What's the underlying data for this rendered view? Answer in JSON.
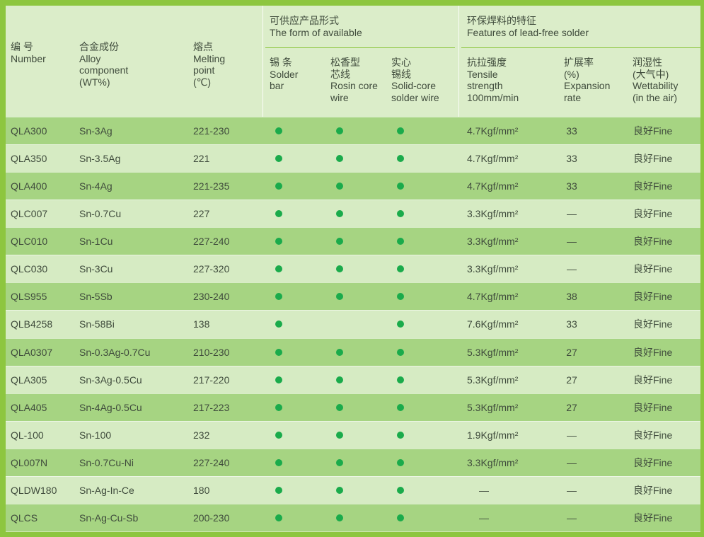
{
  "colors": {
    "frame": "#8dc63f",
    "header_bg": "#dbedc9",
    "row_dark": "#a6d482",
    "row_light": "#d6ebc3",
    "dot": "#1aab4b",
    "rule": "#8dc63f",
    "text": "#3f4b3c"
  },
  "header": {
    "number": {
      "lines": [
        "编 号",
        "Number"
      ]
    },
    "alloy": {
      "lines": [
        "合金成份",
        "Alloy",
        "component",
        "(WT%)"
      ]
    },
    "melting": {
      "lines": [
        "熔点",
        "Melting",
        "point",
        "(℃)"
      ]
    },
    "form_group": {
      "lines": [
        "可供应产品形式",
        "The form of available"
      ],
      "solder_bar": {
        "lines": [
          "锡 条",
          "Solder",
          "bar"
        ]
      },
      "rosin_core_wire": {
        "lines": [
          "松香型",
          "芯线",
          "Rosin core",
          "wire"
        ]
      },
      "solid_core_wire": {
        "lines": [
          "实心",
          "锡线",
          "Solid-core",
          "solder wire"
        ]
      }
    },
    "features_group": {
      "lines": [
        "环保焊料的特征",
        "Features of lead-free solder"
      ],
      "tensile": {
        "lines": [
          "抗拉强度",
          "Tensile",
          "strength",
          "100mm/min"
        ]
      },
      "expansion": {
        "lines": [
          "扩展率",
          "(%)",
          "Expansion",
          "rate"
        ]
      },
      "wettability": {
        "lines": [
          "润湿性",
          "(大气中)",
          "Wettability",
          "(in the air)"
        ]
      }
    }
  },
  "rows": [
    {
      "number": "QLA300",
      "alloy": "Sn-3Ag",
      "melting_point": "221-230",
      "solder_bar": true,
      "rosin_core_wire": true,
      "solid_core_wire": true,
      "tensile_strength": "4.7Kgf/mm²",
      "expansion_rate": "33",
      "wettability": "良好Fine"
    },
    {
      "number": "QLA350",
      "alloy": "Sn-3.5Ag",
      "melting_point": "221",
      "solder_bar": true,
      "rosin_core_wire": true,
      "solid_core_wire": true,
      "tensile_strength": "4.7Kgf/mm²",
      "expansion_rate": "33",
      "wettability": "良好Fine"
    },
    {
      "number": "QLA400",
      "alloy": "Sn-4Ag",
      "melting_point": "221-235",
      "solder_bar": true,
      "rosin_core_wire": true,
      "solid_core_wire": true,
      "tensile_strength": "4.7Kgf/mm²",
      "expansion_rate": "33",
      "wettability": "良好Fine"
    },
    {
      "number": "QLC007",
      "alloy": "Sn-0.7Cu",
      "melting_point": "227",
      "solder_bar": true,
      "rosin_core_wire": true,
      "solid_core_wire": true,
      "tensile_strength": "3.3Kgf/mm²",
      "expansion_rate": "—",
      "wettability": "良好Fine"
    },
    {
      "number": "QLC010",
      "alloy": "Sn-1Cu",
      "melting_point": "227-240",
      "solder_bar": true,
      "rosin_core_wire": true,
      "solid_core_wire": true,
      "tensile_strength": "3.3Kgf/mm²",
      "expansion_rate": "—",
      "wettability": "良好Fine"
    },
    {
      "number": "QLC030",
      "alloy": "Sn-3Cu",
      "melting_point": "227-320",
      "solder_bar": true,
      "rosin_core_wire": true,
      "solid_core_wire": true,
      "tensile_strength": "3.3Kgf/mm²",
      "expansion_rate": "—",
      "wettability": "良好Fine"
    },
    {
      "number": "QLS955",
      "alloy": "Sn-5Sb",
      "melting_point": "230-240",
      "solder_bar": true,
      "rosin_core_wire": true,
      "solid_core_wire": true,
      "tensile_strength": "4.7Kgf/mm²",
      "expansion_rate": "38",
      "wettability": "良好Fine"
    },
    {
      "number": "QLB4258",
      "alloy": "Sn-58Bi",
      "melting_point": "138",
      "solder_bar": true,
      "rosin_core_wire": false,
      "solid_core_wire": true,
      "tensile_strength": "7.6Kgf/mm²",
      "expansion_rate": "33",
      "wettability": "良好Fine"
    },
    {
      "number": "QLA0307",
      "alloy": "Sn-0.3Ag-0.7Cu",
      "melting_point": "210-230",
      "solder_bar": true,
      "rosin_core_wire": true,
      "solid_core_wire": true,
      "tensile_strength": "5.3Kgf/mm²",
      "expansion_rate": "27",
      "wettability": "良好Fine"
    },
    {
      "number": "QLA305",
      "alloy": "Sn-3Ag-0.5Cu",
      "melting_point": "217-220",
      "solder_bar": true,
      "rosin_core_wire": true,
      "solid_core_wire": true,
      "tensile_strength": "5.3Kgf/mm²",
      "expansion_rate": "27",
      "wettability": "良好Fine"
    },
    {
      "number": "QLA405",
      "alloy": "Sn-4Ag-0.5Cu",
      "melting_point": "217-223",
      "solder_bar": true,
      "rosin_core_wire": true,
      "solid_core_wire": true,
      "tensile_strength": "5.3Kgf/mm²",
      "expansion_rate": "27",
      "wettability": "良好Fine"
    },
    {
      "number": "QL-100",
      "alloy": "Sn-100",
      "melting_point": "232",
      "solder_bar": true,
      "rosin_core_wire": true,
      "solid_core_wire": true,
      "tensile_strength": "1.9Kgf/mm²",
      "expansion_rate": "—",
      "wettability": "良好Fine"
    },
    {
      "number": "QL007N",
      "alloy": "Sn-0.7Cu-Ni",
      "melting_point": "227-240",
      "solder_bar": true,
      "rosin_core_wire": true,
      "solid_core_wire": true,
      "tensile_strength": "3.3Kgf/mm²",
      "expansion_rate": "—",
      "wettability": "良好Fine"
    },
    {
      "number": "QLDW180",
      "alloy": "Sn-Ag-In-Ce",
      "melting_point": "180",
      "solder_bar": true,
      "rosin_core_wire": true,
      "solid_core_wire": true,
      "tensile_strength": "—",
      "expansion_rate": "—",
      "wettability": "良好Fine"
    },
    {
      "number": "QLCS",
      "alloy": "Sn-Ag-Cu-Sb",
      "melting_point": "200-230",
      "solder_bar": true,
      "rosin_core_wire": true,
      "solid_core_wire": true,
      "tensile_strength": "—",
      "expansion_rate": "—",
      "wettability": "良好Fine"
    }
  ]
}
